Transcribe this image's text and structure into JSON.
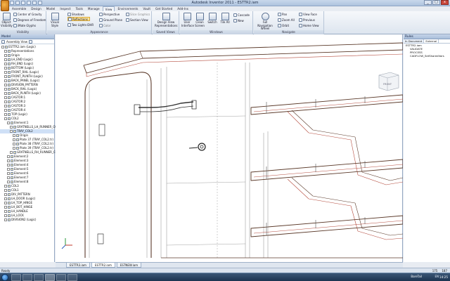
{
  "window": {
    "title": "Autodesk Inventor 2011 - ESTTR2.iam",
    "close": "x",
    "minimize": "_",
    "maximize": "□"
  },
  "menu_tabs": [
    "Assemble",
    "Design",
    "Model",
    "Inspect",
    "Tools",
    "Manage",
    "View",
    "Environments",
    "Vault",
    "Get Started",
    "Add-Ins"
  ],
  "active_menu_tab": "View",
  "ribbon": {
    "visibility": {
      "caption": "Visibility",
      "object_visibility": "Object Visibility",
      "center_of_gravity": "Center of Gravity",
      "degrees_of_freedom": "Degrees of Freedom",
      "ilogic_glyphs": "iMate Glyphs"
    },
    "appearance": {
      "caption": "Appearance",
      "visual_style": "Visual Style",
      "shadows": "Shadows",
      "reflections": "Reflections",
      "two_lights": "Two Lights-DHR",
      "perspective": "Perspective",
      "ground_plane": "Ground Plane",
      "color": "Color",
      "slice_graphics": "Slice Graphics",
      "section_view": "Section View"
    },
    "saved_views": {
      "caption": "Saved Views",
      "design_view": "Design View Representations"
    },
    "windows": {
      "caption": "Windows",
      "user_interface": "User Interface",
      "clean_screen": "Clean Screen",
      "switch": "Switch",
      "tile_all": "Tile All",
      "cascade": "Cascade",
      "new": "New"
    },
    "navigate": {
      "caption": "Navigate",
      "full_navigation_wheel": "Full Navigation Wheel",
      "pan": "Pan",
      "zoom_all": "Zoom All",
      "orbit": "Orbit",
      "view_face": "View Face",
      "previous": "Previous",
      "home_view": "Home View"
    }
  },
  "browser": {
    "title": "Model",
    "view_label": "Assembly View",
    "items": [
      {
        "label": "ESTTR2.iam (Logic)",
        "indent": 0
      },
      {
        "label": "Representations",
        "indent": 1
      },
      {
        "label": "Origin",
        "indent": 1
      },
      {
        "label": "LH_END (Logic)",
        "indent": 1
      },
      {
        "label": "RH_END (Logic)",
        "indent": 1
      },
      {
        "label": "BOTTOM (Logic)",
        "indent": 1
      },
      {
        "label": "FRONT_RAIL (Logic)",
        "indent": 1
      },
      {
        "label": "FRONT_PLINTH (Logic)",
        "indent": 1
      },
      {
        "label": "BACK_PANEL (Logic)",
        "indent": 1
      },
      {
        "label": "DIVISION_PATTERN",
        "indent": 1
      },
      {
        "label": "BACK_RAIL (Logic)",
        "indent": 1
      },
      {
        "label": "BACK_PLINTH (Logic)",
        "indent": 1
      },
      {
        "label": "CASTOR:1",
        "indent": 1
      },
      {
        "label": "CASTOR:2",
        "indent": 1
      },
      {
        "label": "CASTOR:3",
        "indent": 1
      },
      {
        "label": "CASTOR:4",
        "indent": 1
      },
      {
        "label": "TOP (Logic)",
        "indent": 1
      },
      {
        "label": "COL2",
        "indent": 1
      },
      {
        "label": "Element:1",
        "indent": 2
      },
      {
        "label": "GRATNELLS_LH_RUNNER_CO",
        "indent": 3
      },
      {
        "label": "TRAY_COL2",
        "indent": 3
      },
      {
        "label": "Origin",
        "indent": 4
      },
      {
        "label": "Plate 37 (TRAY_COL2.tr)",
        "indent": 4
      },
      {
        "label": "Plate 38 (TRAY_COL2.tr)",
        "indent": 4
      },
      {
        "label": "Plate 39 (TRAY_COL2.tr)",
        "indent": 4
      },
      {
        "label": "GRATNELLS_RH_RUNNER_CO",
        "indent": 3
      },
      {
        "label": "Element:2",
        "indent": 2
      },
      {
        "label": "Element:3",
        "indent": 2
      },
      {
        "label": "Element:4",
        "indent": 2
      },
      {
        "label": "Element:5",
        "indent": 2
      },
      {
        "label": "Element:6",
        "indent": 2
      },
      {
        "label": "Element:7",
        "indent": 2
      },
      {
        "label": "Element:8",
        "indent": 2
      },
      {
        "label": "COL3",
        "indent": 1
      },
      {
        "label": "COL1",
        "indent": 1
      },
      {
        "label": "DIV_PATTERN",
        "indent": 1
      },
      {
        "label": "LH_DOOR (Logic)",
        "indent": 1
      },
      {
        "label": "LH_TOP_HINGE",
        "indent": 1
      },
      {
        "label": "LH_BOT_HINGE",
        "indent": 1
      },
      {
        "label": "LH_HANDLE",
        "indent": 1
      },
      {
        "label": "LH_LOCK",
        "indent": 1
      },
      {
        "label": "DIVISION2 (Logic)",
        "indent": 1
      }
    ],
    "selected_index": 20
  },
  "rules": {
    "title": "Rules",
    "tabs": [
      "In Document",
      "External"
    ],
    "items": [
      {
        "label": "ESTTR2.iam",
        "child": false
      },
      {
        "label": "VALIDATE",
        "child": true
      },
      {
        "label": "PROCESS",
        "child": true
      },
      {
        "label": "CADFLOW_SetSharedVars",
        "child": true
      }
    ]
  },
  "view_cube_label": "FRONT",
  "doc_tabs": [
    "ESTTR3.iam",
    "ESTTR2.iam",
    "ESTNEW.iam"
  ],
  "active_doc_tab": "ESTTR2.iam",
  "status": {
    "text": "Ready",
    "num1": "175",
    "num2": "187"
  },
  "taskbar": {
    "language": "BareTail",
    "tray": "EN",
    "clock": "14:25"
  },
  "colors": {
    "edge_dark": "#5b3a2a",
    "edge_red": "#b44a3c",
    "edge_gray": "#8a8a8a",
    "highlight": "#ffe59a"
  }
}
